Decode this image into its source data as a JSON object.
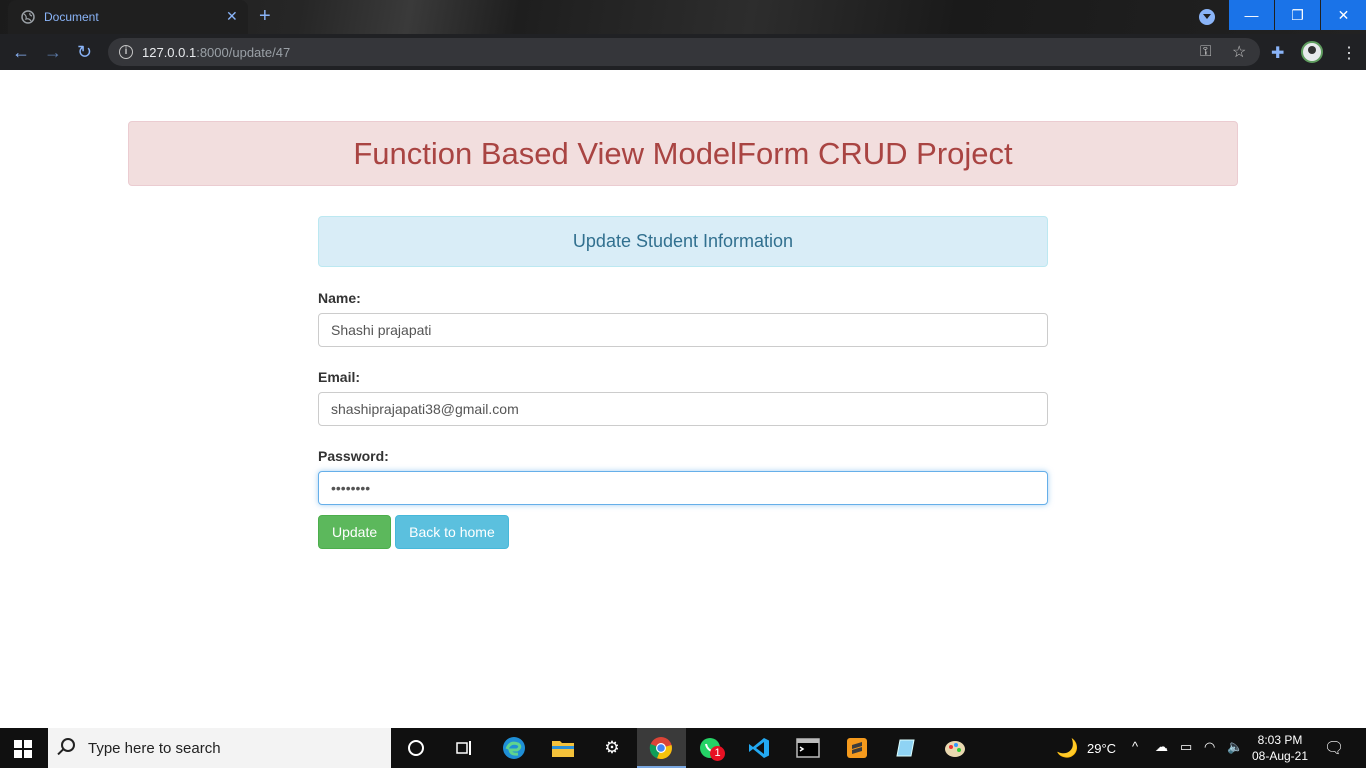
{
  "browser": {
    "tab_title": "Document",
    "tab_close": "✕",
    "new_tab": "+",
    "url_host": "127.0.0.1",
    "url_rest": ":8000/update/47",
    "window_controls": {
      "minimize": "—",
      "restore": "❐",
      "close": "✕"
    },
    "nav": {
      "back": "←",
      "forward": "→",
      "reload": "↻"
    }
  },
  "page": {
    "banner_title": "Function Based View ModelForm CRUD Project",
    "form_title": "Update Student Information",
    "fields": {
      "name_label": "Name:",
      "name_value": "Shashi prajapati",
      "email_label": "Email:",
      "email_value": "shashiprajapati38@gmail.com",
      "password_label": "Password:",
      "password_value": "••••••••"
    },
    "buttons": {
      "update": "Update",
      "back": "Back to home"
    }
  },
  "taskbar": {
    "search_placeholder": "Type here to search",
    "whatsapp_badge": "1",
    "weather": "29°C",
    "time": "8:03 PM",
    "date": "08-Aug-21"
  },
  "colors": {
    "banner_bg": "#f2dede",
    "banner_text": "#a94442",
    "info_bg": "#d9edf7",
    "info_text": "#31708f",
    "success": "#5cb85c",
    "info": "#5bc0de"
  }
}
